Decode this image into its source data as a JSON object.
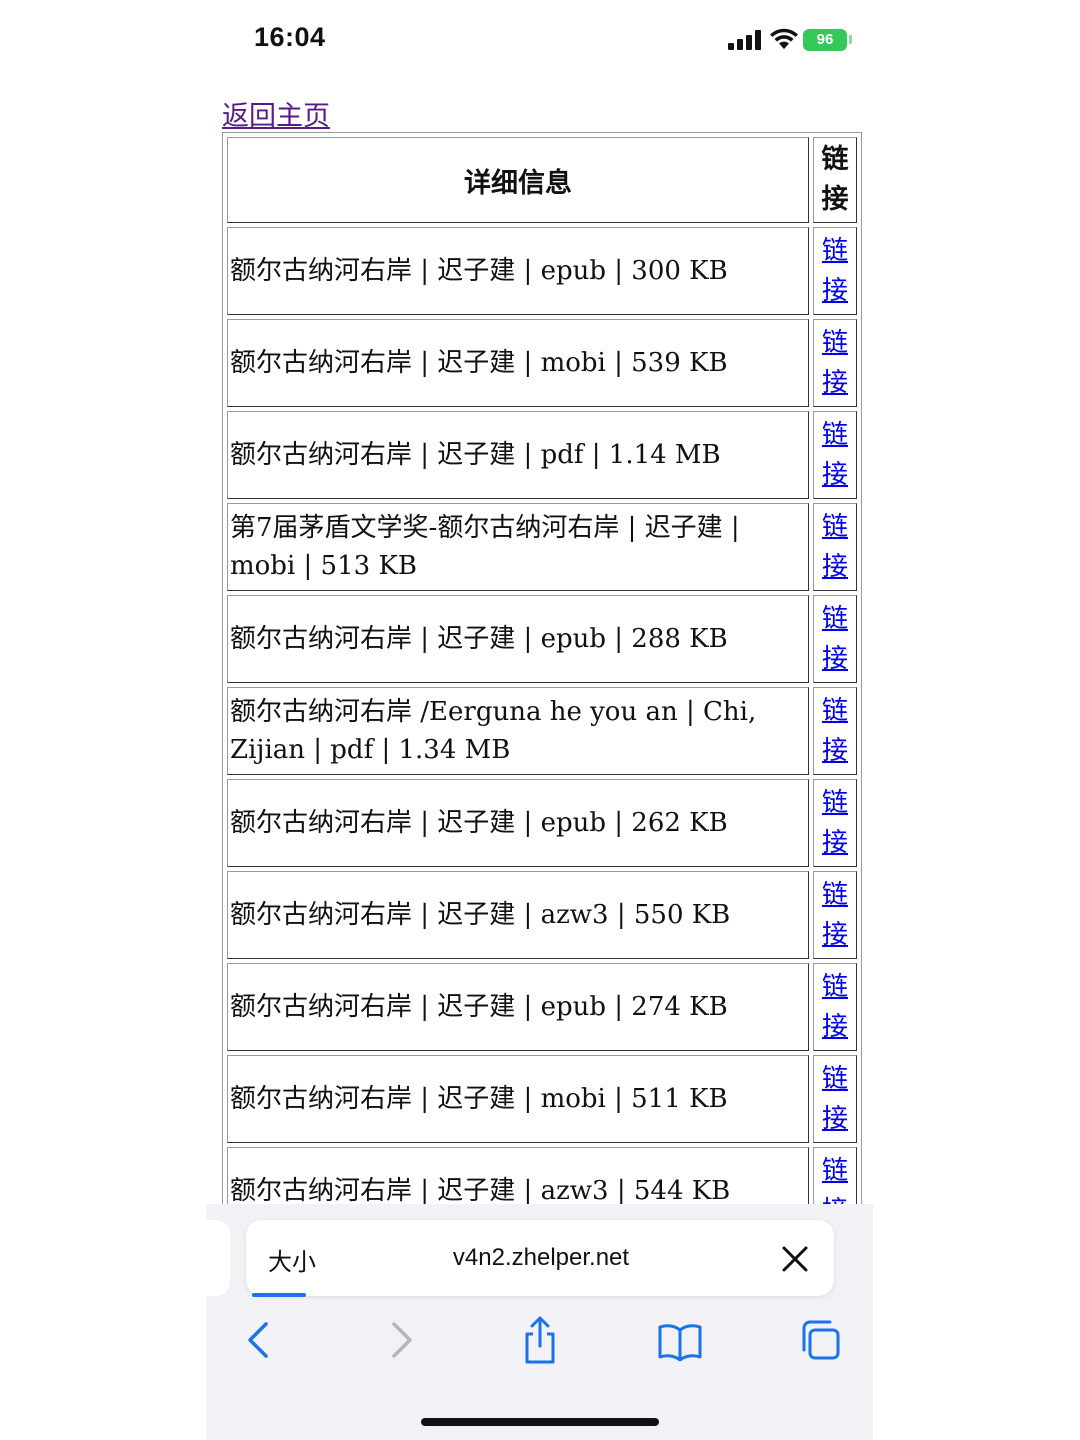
{
  "status_bar": {
    "time": "16:04",
    "battery": "96"
  },
  "page": {
    "back_link": "返回主页",
    "table": {
      "header_info": "详细信息",
      "header_link": "链接",
      "link_text": "链接",
      "rows": [
        "额尔古纳河右岸 | 迟子建 | epub | 300 KB",
        "额尔古纳河右岸 | 迟子建 | mobi | 539 KB",
        "额尔古纳河右岸 | 迟子建 | pdf | 1.14 MB",
        "第7届茅盾文学奖-额尔古纳河右岸 | 迟子建 | mobi | 513 KB",
        "额尔古纳河右岸 | 迟子建 | epub | 288 KB",
        "额尔古纳河右岸 /Eerguna he you an | Chi, Zijian | pdf | 1.34 MB",
        "额尔古纳河右岸 | 迟子建 | epub | 262 KB",
        "额尔古纳河右岸 | 迟子建 | azw3 | 550 KB",
        "额尔古纳河右岸 | 迟子建 | epub | 274 KB",
        "额尔古纳河右岸 | 迟子建 | mobi | 511 KB",
        "额尔古纳河右岸 | 迟子建 | azw3 | 544 KB"
      ]
    }
  },
  "browser": {
    "text_size_label": "大小",
    "url": "v4n2.zhelper.net",
    "icons": {
      "close": "close-icon",
      "back": "chevron-left-icon",
      "forward": "chevron-right-icon",
      "share": "share-icon",
      "bookmarks": "book-icon",
      "tabs": "tabs-icon"
    },
    "accent_color": "#1a73e8"
  }
}
